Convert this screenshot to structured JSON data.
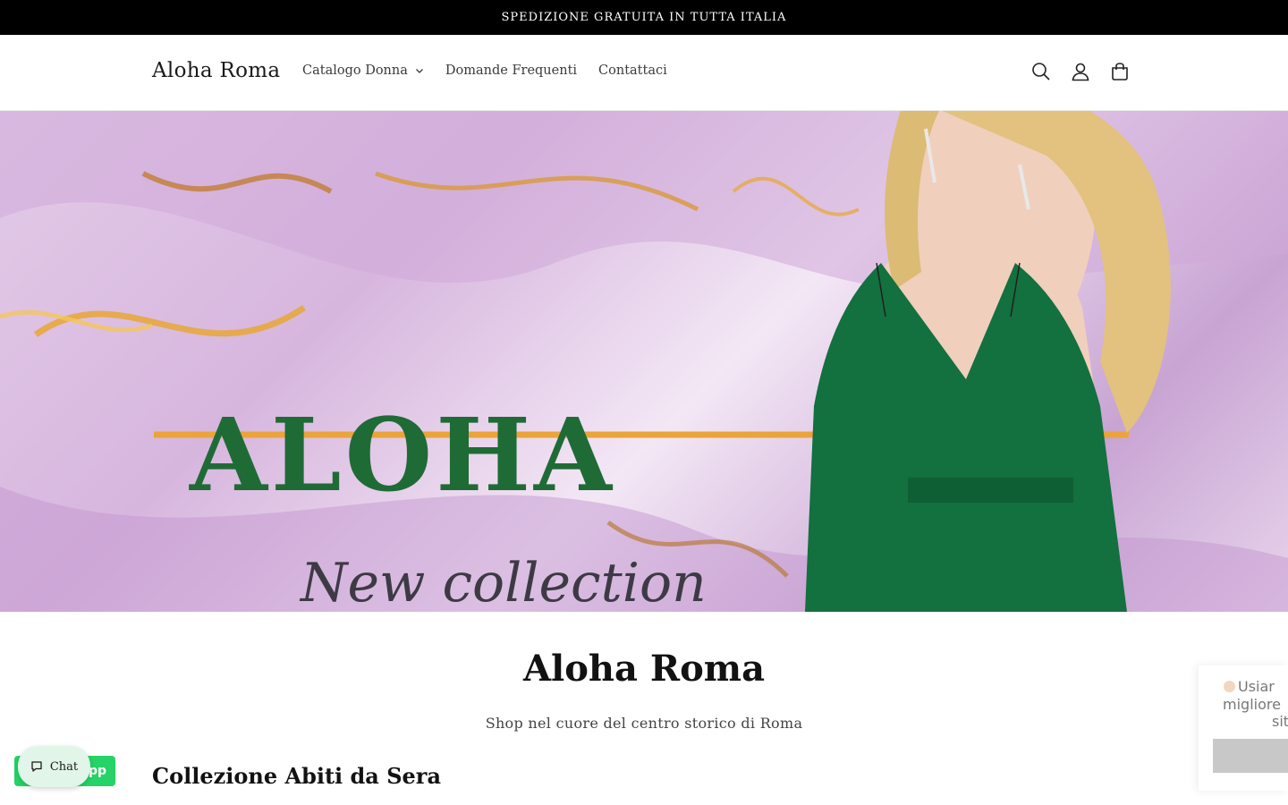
{
  "announcement": {
    "text": "SPEDIZIONE GRATUITA IN TUTTA ITALIA"
  },
  "header": {
    "logo": "Aloha Roma",
    "nav": [
      {
        "label": "Catalogo Donna",
        "has_dropdown": true
      },
      {
        "label": "Domande Frequenti"
      },
      {
        "label": "Contattaci"
      }
    ],
    "icons": [
      "search-icon",
      "account-icon",
      "cart-icon"
    ]
  },
  "hero": {
    "brand_text": "ALOHA",
    "subtitle_text": "New collection",
    "colors": {
      "brand": "#1f6b36",
      "dress": "#13703f",
      "background": "#d7b6de",
      "gold": "#e8a735"
    }
  },
  "intro": {
    "title": "Aloha Roma",
    "subtitle": "Shop nel cuore del centro storico di Roma"
  },
  "collection": {
    "title": "Collezione Abiti da Sera"
  },
  "widgets": {
    "whatsapp_label": "pp",
    "chat_label": "Chat",
    "cookie_lines": [
      "Usiar",
      "migliore",
      "sit"
    ]
  }
}
